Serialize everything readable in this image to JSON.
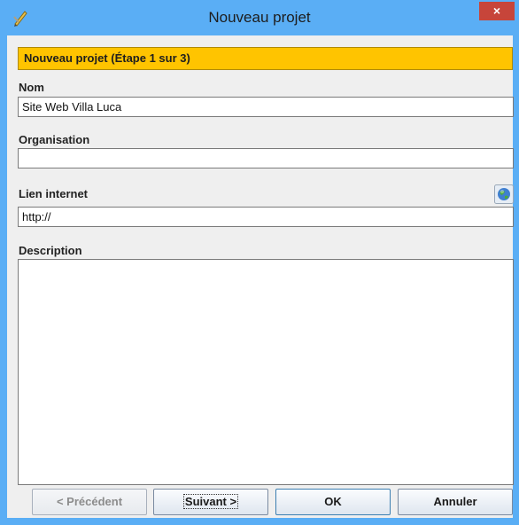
{
  "window": {
    "title": "Nouveau projet",
    "close_label": "×"
  },
  "banner": {
    "text": "Nouveau projet (Étape 1 sur 3)"
  },
  "fields": {
    "nom": {
      "label": "Nom",
      "value": "Site Web Villa Luca"
    },
    "organisation": {
      "label": "Organisation",
      "value": ""
    },
    "lien": {
      "label": "Lien internet",
      "value": "http://"
    },
    "description": {
      "label": "Description",
      "value": ""
    }
  },
  "buttons": {
    "previous": "< Précédent",
    "next": "Suivant >",
    "ok": "OK",
    "cancel": "Annuler"
  },
  "icons": {
    "app": "pencil-icon",
    "web": "globe-icon"
  },
  "colors": {
    "titlebar": "#5aaef5",
    "banner": "#ffc400",
    "close": "#c7453a"
  }
}
